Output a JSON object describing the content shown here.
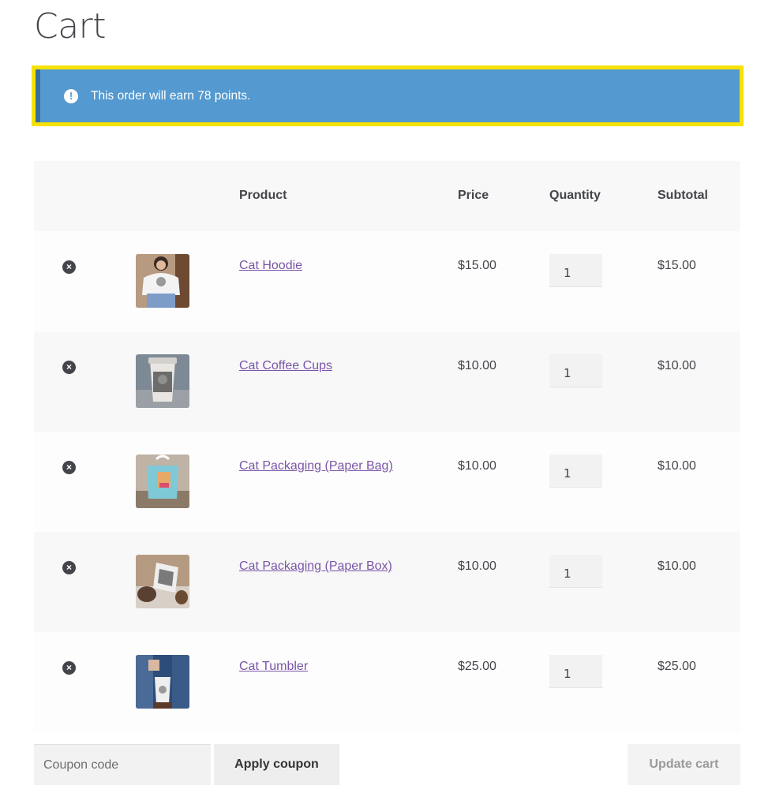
{
  "page": {
    "title": "Cart"
  },
  "notice": {
    "text": "This order will earn 78 points.",
    "icon": "info-icon",
    "icon_glyph": "!"
  },
  "table": {
    "headers": {
      "product": "Product",
      "price": "Price",
      "quantity": "Quantity",
      "subtotal": "Subtotal"
    },
    "rows": [
      {
        "name": "Cat Hoodie",
        "price": "$15.00",
        "quantity": "1",
        "subtotal": "$15.00",
        "thumb": "hoodie-thumbnail"
      },
      {
        "name": "Cat Coffee Cups",
        "price": "$10.00",
        "quantity": "1",
        "subtotal": "$10.00",
        "thumb": "coffee-cup-thumbnail"
      },
      {
        "name": "Cat Packaging (Paper Bag)",
        "price": "$10.00",
        "quantity": "1",
        "subtotal": "$10.00",
        "thumb": "paper-bag-thumbnail"
      },
      {
        "name": "Cat Packaging (Paper Box)",
        "price": "$10.00",
        "quantity": "1",
        "subtotal": "$10.00",
        "thumb": "paper-box-thumbnail"
      },
      {
        "name": "Cat Tumbler",
        "price": "$25.00",
        "quantity": "1",
        "subtotal": "$25.00",
        "thumb": "tumbler-thumbnail"
      }
    ]
  },
  "actions": {
    "coupon_placeholder": "Coupon code",
    "apply_label": "Apply coupon",
    "update_label": "Update cart"
  },
  "colors": {
    "notice_bg": "#5499cf",
    "highlight_outline": "#f6e200",
    "link": "#7a55a8",
    "text": "#43454b"
  }
}
